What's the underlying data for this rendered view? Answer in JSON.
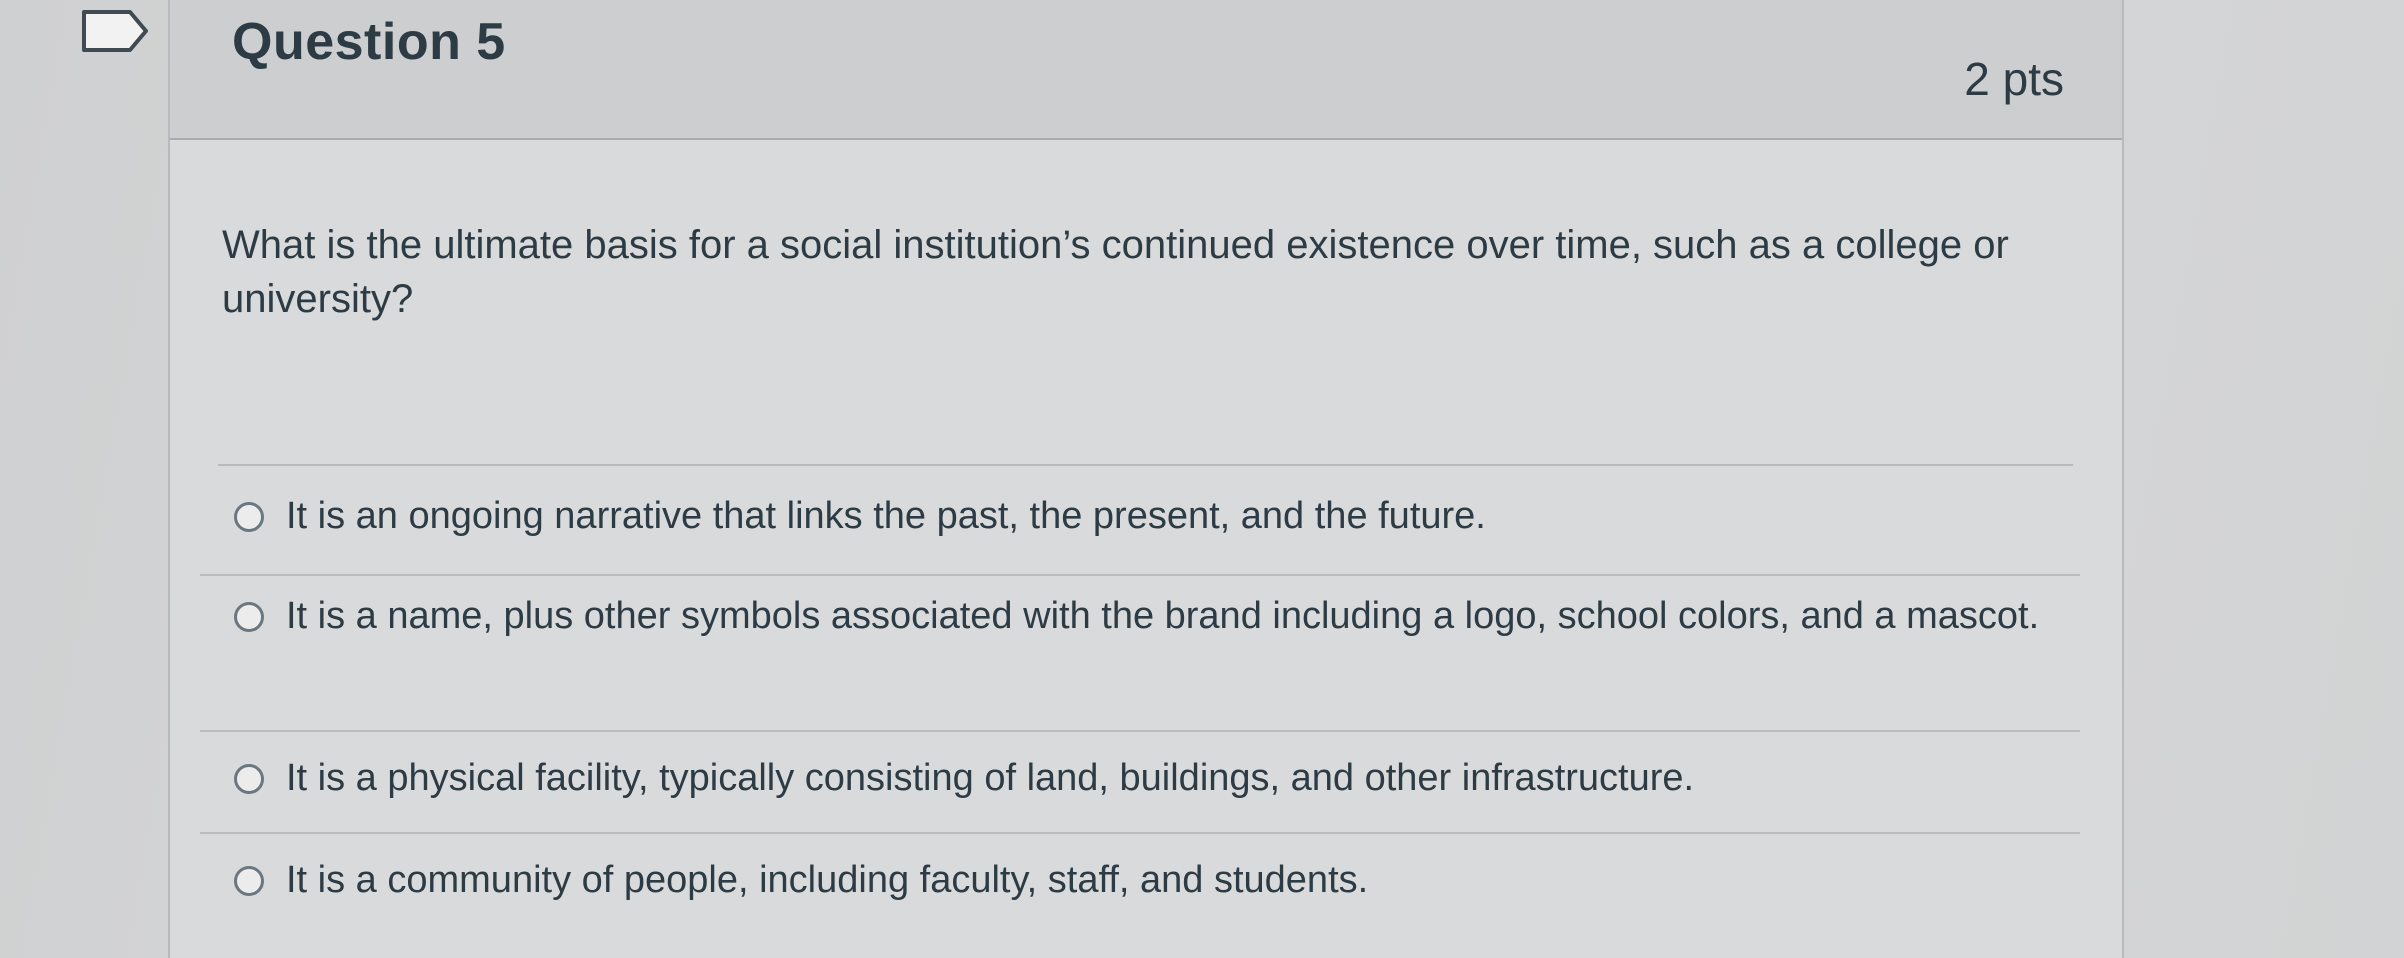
{
  "question": {
    "title": "Question 5",
    "points": "2 pts",
    "text": "What is the ultimate basis for a social institution’s continued existence over time, such as a college or university?",
    "flag_icon": "flag-bookmark-icon"
  },
  "answers": [
    {
      "label": "It is an ongoing narrative that links the past, the present, and the future.",
      "selected": false
    },
    {
      "label": "It is a name, plus other symbols associated with the brand including a logo, school colors, and a mascot.",
      "selected": false
    },
    {
      "label": "It is a physical facility, typically consisting of land, buildings, and other infrastructure.",
      "selected": false
    },
    {
      "label": "It is a community of people, including faculty, staff, and students.",
      "selected": false
    }
  ],
  "colors": {
    "text": "#2d3b45",
    "background": "#d4d5d6",
    "radio_border": "#6b7780"
  }
}
